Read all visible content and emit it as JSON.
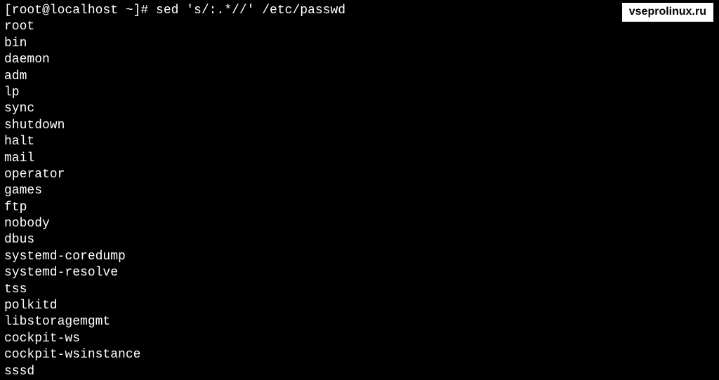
{
  "watermark": "vseprolinux.ru",
  "prompt": "[root@localhost ~]# sed 's/:.*//' /etc/passwd",
  "output": [
    "root",
    "bin",
    "daemon",
    "adm",
    "lp",
    "sync",
    "shutdown",
    "halt",
    "mail",
    "operator",
    "games",
    "ftp",
    "nobody",
    "dbus",
    "systemd-coredump",
    "systemd-resolve",
    "tss",
    "polkitd",
    "libstoragemgmt",
    "cockpit-ws",
    "cockpit-wsinstance",
    "sssd"
  ]
}
